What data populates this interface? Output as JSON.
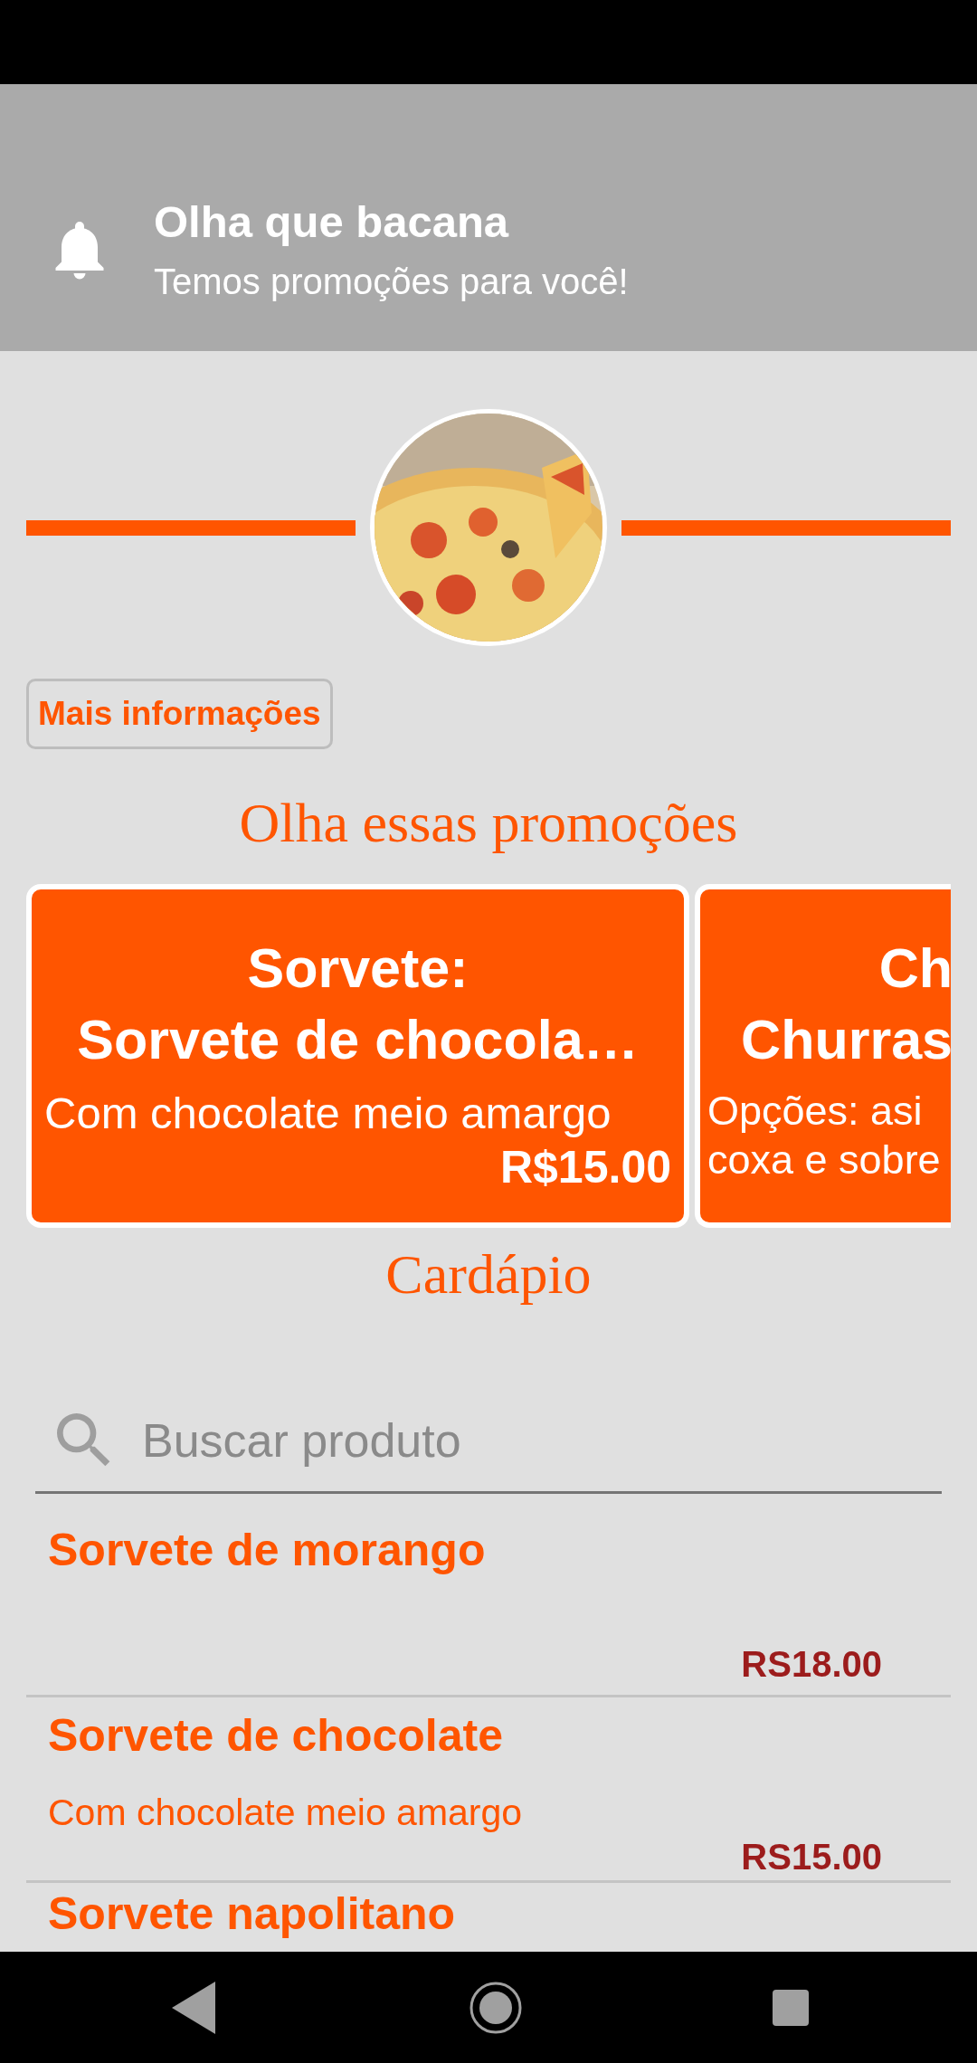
{
  "notification": {
    "title": "Olha que bacana",
    "text": "Temos promoções para você!"
  },
  "info_button": "Mais informações",
  "promotions": {
    "heading": "Olha essas promoções",
    "cards": [
      {
        "kind": "full",
        "title_lines": [
          "Sorvete:",
          "Sorvete de chocola…"
        ],
        "description_lines": [
          "Com chocolate meio amargo"
        ],
        "price": "R$15.00"
      },
      {
        "kind": "cut",
        "title_lines": [
          "Ch",
          "Churras"
        ],
        "description_lines": [
          "Opções: asi",
          "coxa e sobre"
        ]
      }
    ]
  },
  "menu": {
    "heading": "Cardápio",
    "search": {
      "placeholder": "Buscar produto"
    },
    "items": [
      {
        "name": "Sorvete de morango",
        "price": "RS18.00"
      },
      {
        "name": "Sorvete de chocolate",
        "description": "Com chocolate meio amargo",
        "price": "RS15.00"
      },
      {
        "name": "Sorvete napolitano"
      }
    ]
  }
}
